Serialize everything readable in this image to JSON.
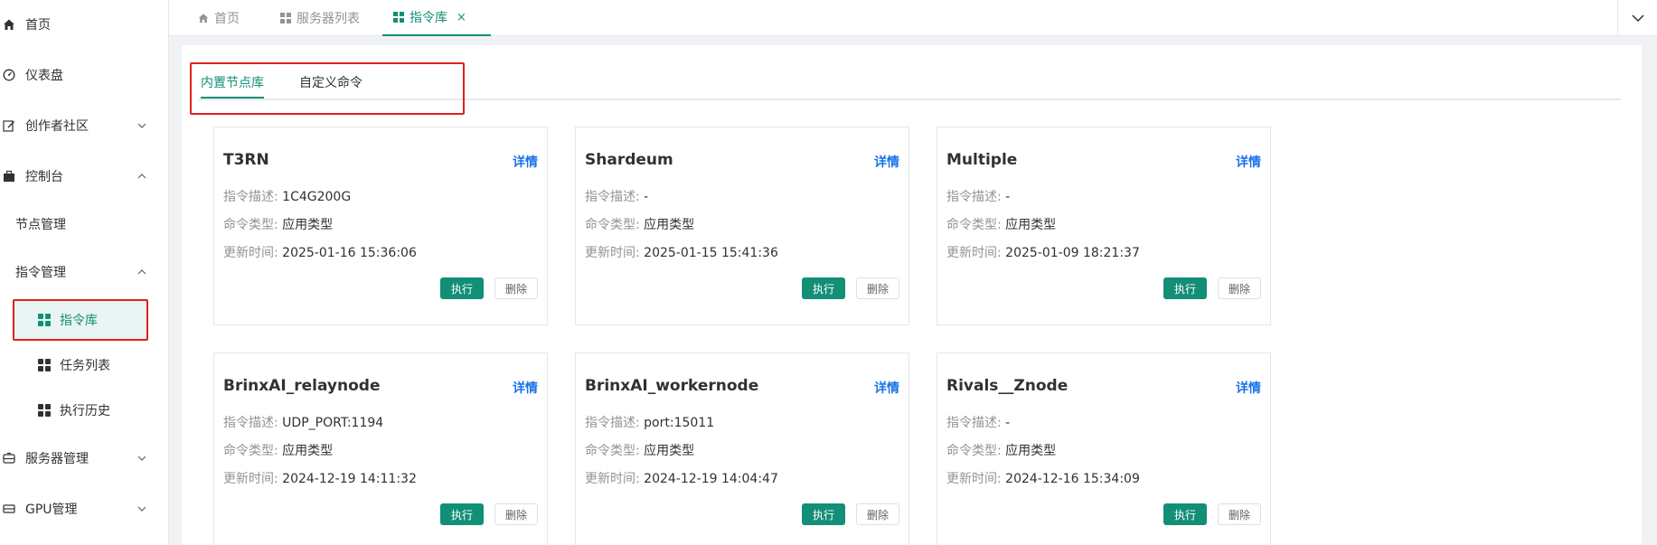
{
  "sidebar": {
    "items": [
      {
        "label": "首页",
        "icon": "home-icon"
      },
      {
        "label": "仪表盘",
        "icon": "gauge-icon"
      },
      {
        "label": "创作者社区",
        "icon": "edit-icon",
        "expanded": false
      },
      {
        "label": "控制台",
        "icon": "briefcase-icon",
        "expanded": true
      }
    ],
    "console_children": {
      "node_mgmt": "节点管理",
      "cmd_mgmt": "指令管理",
      "cmd_library": "指令库",
      "task_list": "任务列表",
      "exec_history": "执行历史"
    },
    "server_mgmt": "服务器管理",
    "gpu_mgmt": "GPU管理"
  },
  "tabs": [
    {
      "label": "首页"
    },
    {
      "label": "服务器列表"
    },
    {
      "label": "指令库",
      "active": true,
      "closable": true
    }
  ],
  "inner_tabs": [
    {
      "label": "内置节点库",
      "active": true
    },
    {
      "label": "自定义命令"
    }
  ],
  "card_labels": {
    "detail": "详情",
    "desc_key": "指令描述:",
    "type_key": "命令类型:",
    "time_key": "更新时间:",
    "exec": "执行",
    "delete": "删除"
  },
  "cards": [
    {
      "title": "T3RN",
      "desc": "1C4G200G",
      "type": "应用类型",
      "time": "2025-01-16 15:36:06"
    },
    {
      "title": "Shardeum",
      "desc": "-",
      "type": "应用类型",
      "time": "2025-01-15 15:41:36"
    },
    {
      "title": "Multiple",
      "desc": "-",
      "type": "应用类型",
      "time": "2025-01-09 18:21:37"
    },
    {
      "title": "BrinxAI_relaynode",
      "desc": "UDP_PORT:1194",
      "type": "应用类型",
      "time": "2024-12-19 14:11:32"
    },
    {
      "title": "BrinxAI_workernode",
      "desc": "port:15011",
      "type": "应用类型",
      "time": "2024-12-19 14:04:47"
    },
    {
      "title": "Rivals__Znode",
      "desc": "-",
      "type": "应用类型",
      "time": "2024-12-16 15:34:09"
    }
  ],
  "colors": {
    "accent": "#128f76",
    "link": "#1a73e8",
    "highlight": "#e02020"
  }
}
